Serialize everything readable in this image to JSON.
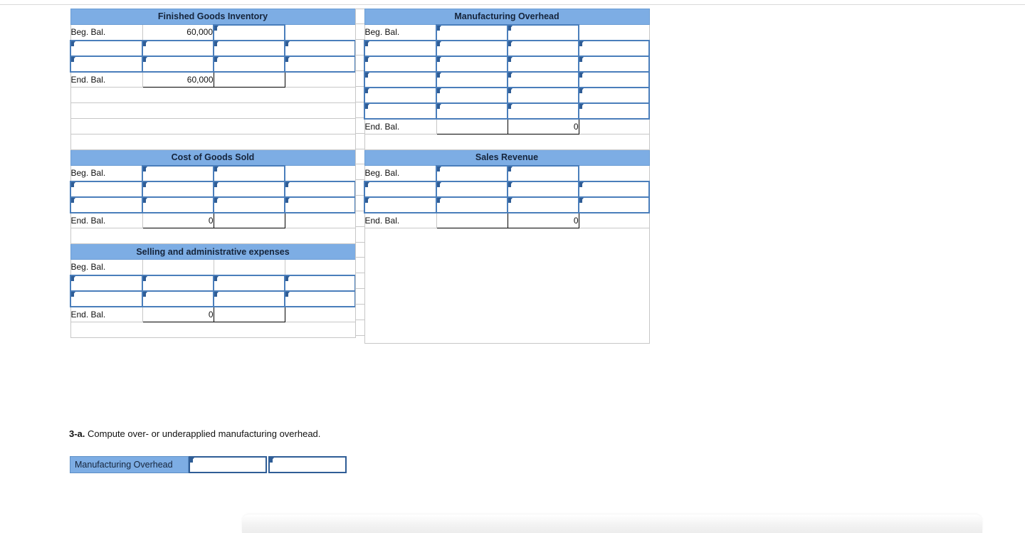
{
  "accounts": [
    {
      "id": "finished-goods-inventory",
      "title": "Finished Goods Inventory",
      "beg_label": "Beg. Bal.",
      "end_label": "End. Bal.",
      "beg_value": "60,000",
      "end_value": "60,000",
      "end_value_column": 2,
      "beg_row_inputs": [
        3
      ],
      "entry_rows": 2,
      "side": "left"
    },
    {
      "id": "manufacturing-overhead",
      "title": "Manufacturing Overhead",
      "beg_label": "Beg. Bal.",
      "end_label": "End. Bal.",
      "beg_value": "",
      "end_value": "0",
      "end_value_column": 3,
      "beg_row_inputs": [
        2,
        3
      ],
      "entry_rows": 5,
      "side": "right"
    },
    {
      "id": "cost-of-goods-sold",
      "title": "Cost of Goods Sold",
      "beg_label": "Beg. Bal.",
      "end_label": "End. Bal.",
      "beg_value": "",
      "end_value": "0",
      "end_value_column": 2,
      "beg_row_inputs": [
        2,
        3
      ],
      "entry_rows": 2,
      "side": "left"
    },
    {
      "id": "sales-revenue",
      "title": "Sales Revenue",
      "beg_label": "Beg. Bal.",
      "end_label": "End. Bal.",
      "beg_value": "",
      "end_value": "0",
      "end_value_column": 3,
      "beg_row_inputs": [
        2,
        3
      ],
      "entry_rows": 2,
      "side": "right"
    },
    {
      "id": "selling-and-administrative-expenses",
      "title": "Selling and administrative expenses",
      "beg_label": "Beg. Bal.",
      "end_label": "End. Bal.",
      "beg_value": "",
      "end_value": "0",
      "end_value_column": 2,
      "beg_row_inputs": [],
      "entry_rows": 2,
      "side": "left"
    }
  ],
  "question": {
    "number": "3-a.",
    "text": "Compute over- or underapplied manufacturing overhead.",
    "row_label": "Manufacturing Overhead",
    "input_1_value": "",
    "input_2_value": ""
  },
  "colors": {
    "header_blue": "#7dade4",
    "input_border_blue": "#4a7ebb",
    "marker_blue": "#2f5d96",
    "grid_gray": "#c7c7c7",
    "text": "#111111"
  },
  "icons": {
    "cell_marker": "input-marker-triangle-icon"
  }
}
